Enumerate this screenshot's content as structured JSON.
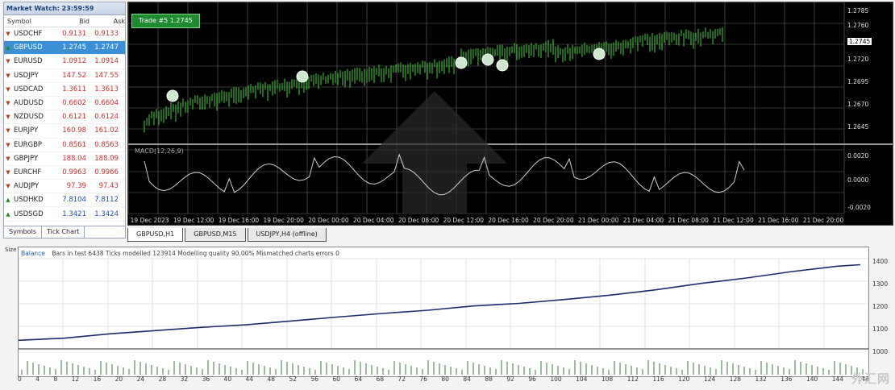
{
  "market_watch": {
    "title": "Market Watch: 23:59:59",
    "headers": [
      "Symbol",
      "Bid",
      "Ask"
    ],
    "rows": [
      {
        "symbol": "USDCHF",
        "bid": "0.9131",
        "ask": "0.9133",
        "dir": "down"
      },
      {
        "symbol": "GBPUSD",
        "bid": "1.2745",
        "ask": "1.2747",
        "dir": "up",
        "selected": true
      },
      {
        "symbol": "EURUSD",
        "bid": "1.0912",
        "ask": "1.0914",
        "dir": "down"
      },
      {
        "symbol": "USDJPY",
        "bid": "147.52",
        "ask": "147.55",
        "dir": "down"
      },
      {
        "symbol": "USDCAD",
        "bid": "1.3611",
        "ask": "1.3613",
        "dir": "down"
      },
      {
        "symbol": "AUDUSD",
        "bid": "0.6602",
        "ask": "0.6604",
        "dir": "down"
      },
      {
        "symbol": "NZDUSD",
        "bid": "0.6121",
        "ask": "0.6124",
        "dir": "down"
      },
      {
        "symbol": "EURJPY",
        "bid": "160.98",
        "ask": "161.02",
        "dir": "down"
      },
      {
        "symbol": "EURGBP",
        "bid": "0.8561",
        "ask": "0.8563",
        "dir": "down"
      },
      {
        "symbol": "GBPJPY",
        "bid": "188.04",
        "ask": "188.09",
        "dir": "down"
      },
      {
        "symbol": "EURCHF",
        "bid": "0.9963",
        "ask": "0.9966",
        "dir": "down"
      },
      {
        "symbol": "AUDJPY",
        "bid": "97.39",
        "ask": "97.43",
        "dir": "down"
      },
      {
        "symbol": "USDHKD",
        "bid": "7.8104",
        "ask": "7.8112",
        "dir": "up"
      },
      {
        "symbol": "USDSGD",
        "bid": "1.3421",
        "ask": "1.3424",
        "dir": "up"
      }
    ],
    "footer_tabs": [
      "Symbols",
      "Tick Chart"
    ]
  },
  "main_chart": {
    "badge": "Trade #5 1.2745",
    "indicator_label": "MACD(12,26,9)",
    "time_labels": [
      "19 Dec 2023",
      "19 Dec 12:00",
      "19 Dec 16:00",
      "19 Dec 20:00",
      "20 Dec 00:00",
      "20 Dec 04:00",
      "20 Dec 08:00",
      "20 Dec 12:00",
      "20 Dec 16:00",
      "20 Dec 20:00",
      "21 Dec 00:00",
      "21 Dec 04:00",
      "21 Dec 08:00",
      "21 Dec 12:00",
      "21 Dec 16:00",
      "21 Dec 20:00"
    ],
    "price_ticks": [
      "1.2785",
      "1.2760",
      "1.2745",
      "1.2720",
      "1.2695",
      "1.2670",
      "1.2645",
      "0.0020",
      "0.0000",
      "-0.0020"
    ],
    "current_price": "1.2745",
    "bull_color": "#35b52b",
    "grid_color": "#6a6a6a",
    "background": "#000000"
  },
  "chart_tabs": [
    "GBPUSD,H1",
    "GBPUSD,M15",
    "USDJPY,H4 (offline)"
  ],
  "equity_graph": {
    "header_tag": "Balance",
    "header_text": "Bars in test 6438 Ticks modelled 123914 Modelling quality 90.00% Mismatched charts errors 0",
    "y_ticks": [
      "1400",
      "1300",
      "1200",
      "1100",
      "1000"
    ],
    "x_ticks": [
      "0",
      "4",
      "8",
      "12",
      "16",
      "20",
      "24",
      "28",
      "32",
      "36",
      "40",
      "44",
      "48",
      "52",
      "56",
      "60",
      "64",
      "68",
      "72",
      "76",
      "80",
      "84",
      "88",
      "92",
      "96",
      "100",
      "104",
      "108",
      "112",
      "116",
      "120",
      "124",
      "128",
      "132",
      "136",
      "140",
      "144",
      "148"
    ],
    "left_marker": "Size",
    "line_color": "#1f2a6b",
    "volume_color": "#3a7a3a"
  },
  "watermark": "外汇网",
  "chart_data": {
    "type": "line",
    "title": "",
    "xlabel": "",
    "ylabel": "",
    "x": [
      0,
      8,
      16,
      24,
      32,
      40,
      48,
      56,
      64,
      72,
      80,
      88,
      96,
      104,
      112,
      120,
      128,
      136,
      144,
      148
    ],
    "values": [
      1000,
      1010,
      1030,
      1045,
      1060,
      1072,
      1090,
      1108,
      1125,
      1140,
      1160,
      1172,
      1190,
      1210,
      1235,
      1265,
      1290,
      1320,
      1345,
      1352
    ],
    "ylim": [
      960,
      1380
    ],
    "grid": true
  }
}
